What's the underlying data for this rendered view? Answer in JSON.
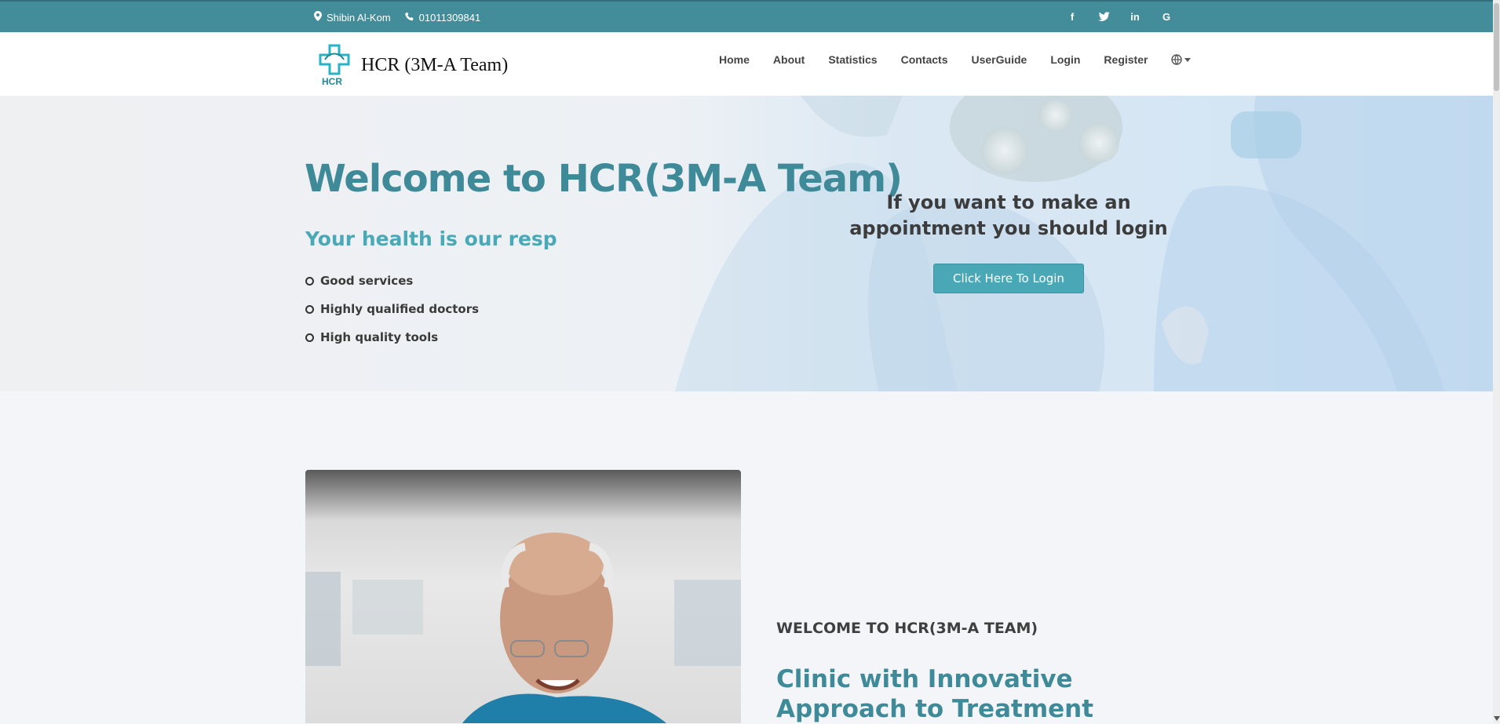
{
  "topbar": {
    "location": "Shibin Al-Kom",
    "phone": "01011309841",
    "social_icons": [
      "facebook-icon",
      "twitter-icon",
      "linkedin-icon",
      "google-icon"
    ]
  },
  "nav": {
    "brand": "HCR (3M-A Team)",
    "logo_text": "HCR",
    "items": [
      "Home",
      "About",
      "Statistics",
      "Contacts",
      "UserGuide",
      "Login",
      "Register"
    ],
    "language_icon": "globe-icon"
  },
  "hero": {
    "title": "Welcome to HCR(3M-A Team)",
    "subtitle": "Your health is our resp",
    "features": [
      "Good services",
      "Highly qualified doctors",
      "High quality tools"
    ],
    "cta_text": "If you want to make an appointment you should login",
    "cta_button": "Click Here To Login"
  },
  "about": {
    "kicker": "WELCOME TO HCR(3M-A TEAM)",
    "title": "Clinic with Innovative Approach to Treatment"
  },
  "colors": {
    "topbar": "#438d9b",
    "accent": "#4aa7b5",
    "title": "#3f8a98",
    "background": "#f3f5f9"
  }
}
